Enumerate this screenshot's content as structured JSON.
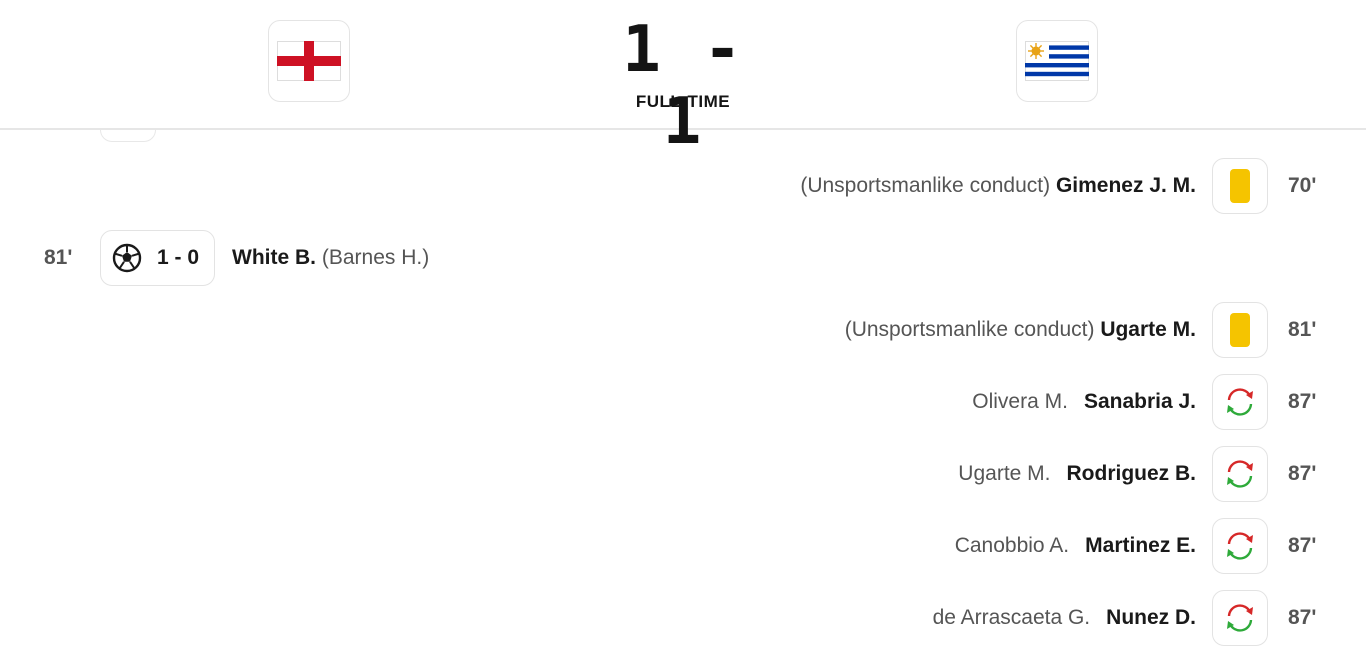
{
  "match": {
    "home_team": "England",
    "away_team": "Uruguay",
    "score": "1 - 1",
    "status": "FULL-TIME",
    "colors": {
      "england_red": "#ce1124",
      "uruguay_blue": "#0038a8",
      "sun_gold": "#e8a317",
      "yellow_card": "#f5c400",
      "sub_in_green": "#2eaa3a",
      "sub_out_red": "#d62828"
    }
  },
  "events": [
    {
      "side": "away",
      "type": "yellow-card",
      "minute": "70'",
      "player": "Gimenez J. M.",
      "detail": "(Unsportsmanlike conduct)"
    },
    {
      "side": "home",
      "type": "goal",
      "minute": "81'",
      "score": "1 - 0",
      "player": "White B.",
      "assist": "(Barnes H.)"
    },
    {
      "side": "away",
      "type": "yellow-card",
      "minute": "81'",
      "player": "Ugarte M.",
      "detail": "(Unsportsmanlike conduct)"
    },
    {
      "side": "away",
      "type": "substitution",
      "minute": "87'",
      "player_in": "Sanabria J.",
      "player_out": "Olivera M."
    },
    {
      "side": "away",
      "type": "substitution",
      "minute": "87'",
      "player_in": "Rodriguez B.",
      "player_out": "Ugarte M."
    },
    {
      "side": "away",
      "type": "substitution",
      "minute": "87'",
      "player_in": "Martinez E.",
      "player_out": "Canobbio A."
    },
    {
      "side": "away",
      "type": "substitution",
      "minute": "87'",
      "player_in": "Nunez D.",
      "player_out": "de Arrascaeta G."
    }
  ]
}
